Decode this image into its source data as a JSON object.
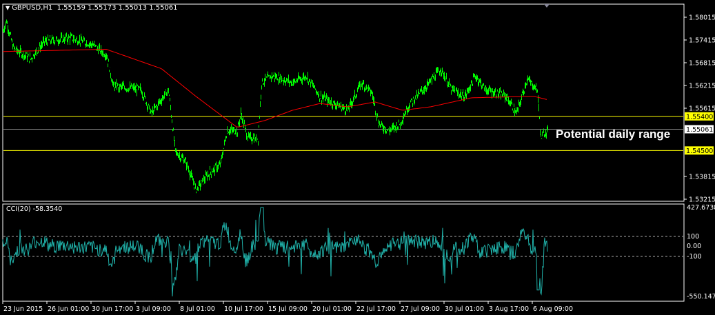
{
  "header": {
    "symbol": "GBPUSD,H1",
    "ohlc": "1.55159 1.55173 1.55013 1.55061"
  },
  "annotation": "Potential daily range",
  "indicator": {
    "label": "CCI(20) -58.3540",
    "levels": [
      "100",
      "0.00",
      "-100"
    ],
    "max_label": "427.6738",
    "min_label": "-550.1471"
  },
  "colors": {
    "price": "#00ff00",
    "ma": "#ff0000",
    "cci": "#20b2aa",
    "level_line": "#ffff00",
    "grid": "#ffffff"
  },
  "chart_data": {
    "type": "line",
    "title": "GBPUSD,H1",
    "price_ticks": [
      "1.58015",
      "1.57415",
      "1.56815",
      "1.56215",
      "1.55615",
      "1.53815",
      "1.53215"
    ],
    "horizontal_lines": [
      {
        "label": "1.55400",
        "value": 1.554,
        "color": "#ffff00"
      },
      {
        "label": "1.54500",
        "value": 1.545,
        "color": "#ffff00"
      }
    ],
    "current_price": {
      "label": "1.55061",
      "value": 1.55061
    },
    "ylim": [
      1.5317,
      1.5855
    ],
    "time_ticks": [
      "23 Jun 2015",
      "26 Jun 01:00",
      "30 Jun 17:00",
      "3 Jul 09:00",
      "8 Jul 01:00",
      "10 Jul 17:00",
      "15 Jul 09:00",
      "20 Jul 01:00",
      "22 Jul 17:00",
      "27 Jul 09:00",
      "30 Jul 01:00",
      "3 Aug 17:00",
      "6 Aug 09:00"
    ],
    "price_series": {
      "name": "GBPUSD",
      "x": [
        0,
        5,
        15,
        40,
        60,
        100,
        130,
        150,
        160,
        200,
        215,
        240,
        250,
        265,
        280,
        300,
        315,
        325,
        340,
        345,
        355,
        370,
        375,
        390,
        420,
        440,
        460,
        480,
        500,
        520,
        535,
        545,
        560,
        575,
        590,
        610,
        635,
        650,
        670,
        685,
        700,
        730,
        745,
        760,
        775,
        780,
        790
      ],
      "y": [
        1.5765,
        1.5792,
        1.572,
        1.5692,
        1.5738,
        1.5747,
        1.5729,
        1.5702,
        1.562,
        1.5611,
        1.5547,
        1.5611,
        1.5447,
        1.542,
        1.5347,
        1.5392,
        1.5411,
        1.5502,
        1.5502,
        1.5547,
        1.5483,
        1.5483,
        1.5629,
        1.5647,
        1.5629,
        1.5647,
        1.5592,
        1.5574,
        1.5556,
        1.5629,
        1.5602,
        1.552,
        1.5502,
        1.552,
        1.5574,
        1.5611,
        1.5665,
        1.5611,
        1.5592,
        1.5647,
        1.5611,
        1.5592,
        1.5547,
        1.5638,
        1.5611,
        1.5483,
        1.5506
      ]
    },
    "ma_series": {
      "name": "MA",
      "x": [
        0,
        150,
        230,
        280,
        340,
        380,
        420,
        460,
        500,
        540,
        580,
        620,
        680,
        770,
        790
      ],
      "y": [
        1.5711,
        1.5717,
        1.5666,
        1.5593,
        1.5511,
        1.5529,
        1.5556,
        1.5574,
        1.5565,
        1.5578,
        1.5556,
        1.5565,
        1.5589,
        1.5593,
        1.5584
      ]
    },
    "cci": {
      "name": "CCI(20)",
      "ylim": [
        -550.1471,
        427.6738
      ],
      "levels": [
        100,
        0,
        -100
      ],
      "last": -58.354
    }
  }
}
